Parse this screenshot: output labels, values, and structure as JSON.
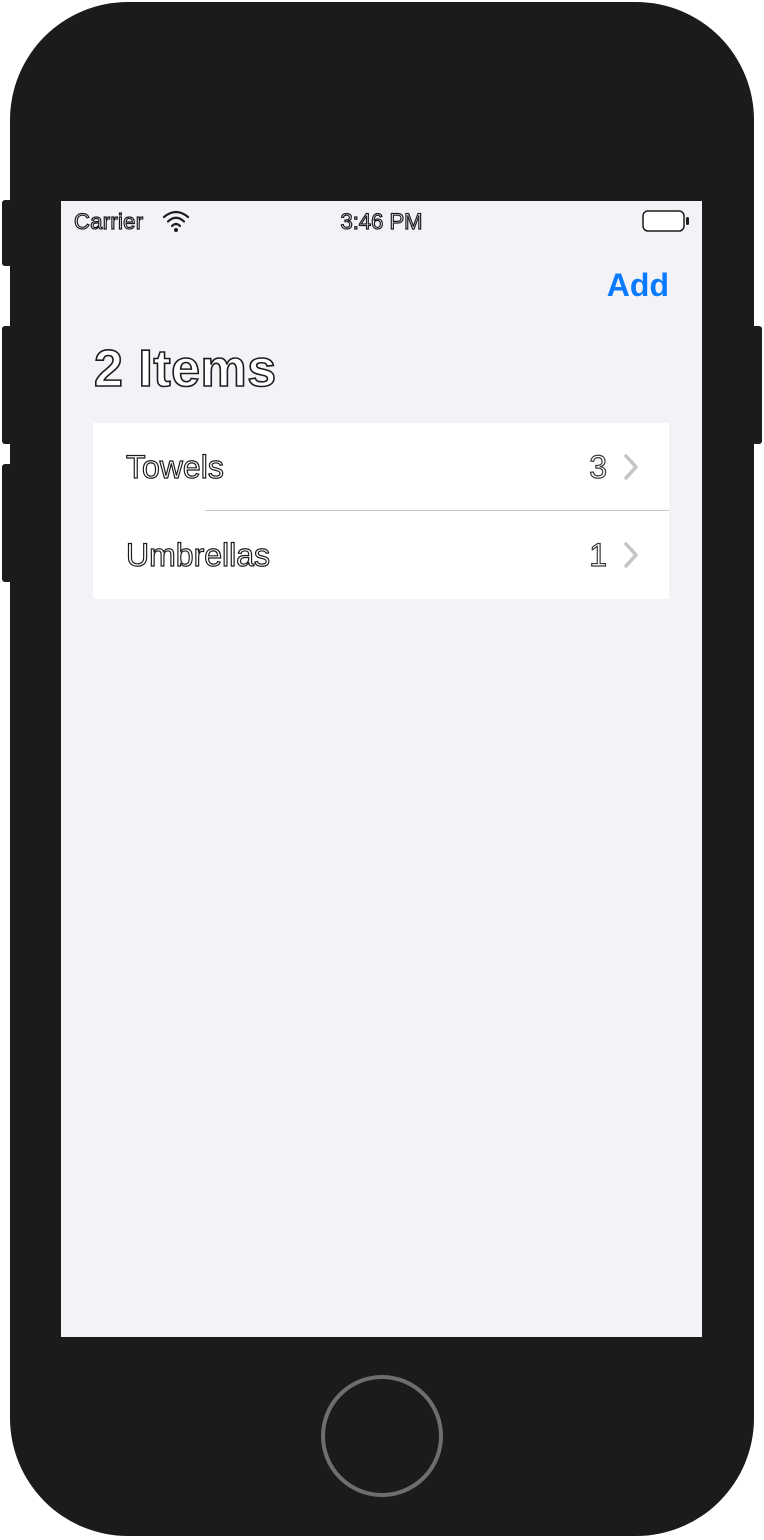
{
  "status_bar": {
    "carrier": "Carrier",
    "time": "3:46 PM",
    "wifi_icon": "wifi-icon",
    "battery_icon": "battery-icon"
  },
  "nav": {
    "add_label": "Add",
    "title": "2 Items"
  },
  "items": [
    {
      "label": "Towels",
      "count": "3"
    },
    {
      "label": "Umbrellas",
      "count": "1"
    }
  ],
  "colors": {
    "accent": "#0a7aff",
    "background": "#f2f2f7",
    "device": "#1b1b1b",
    "separator": "#c6c6c8"
  }
}
